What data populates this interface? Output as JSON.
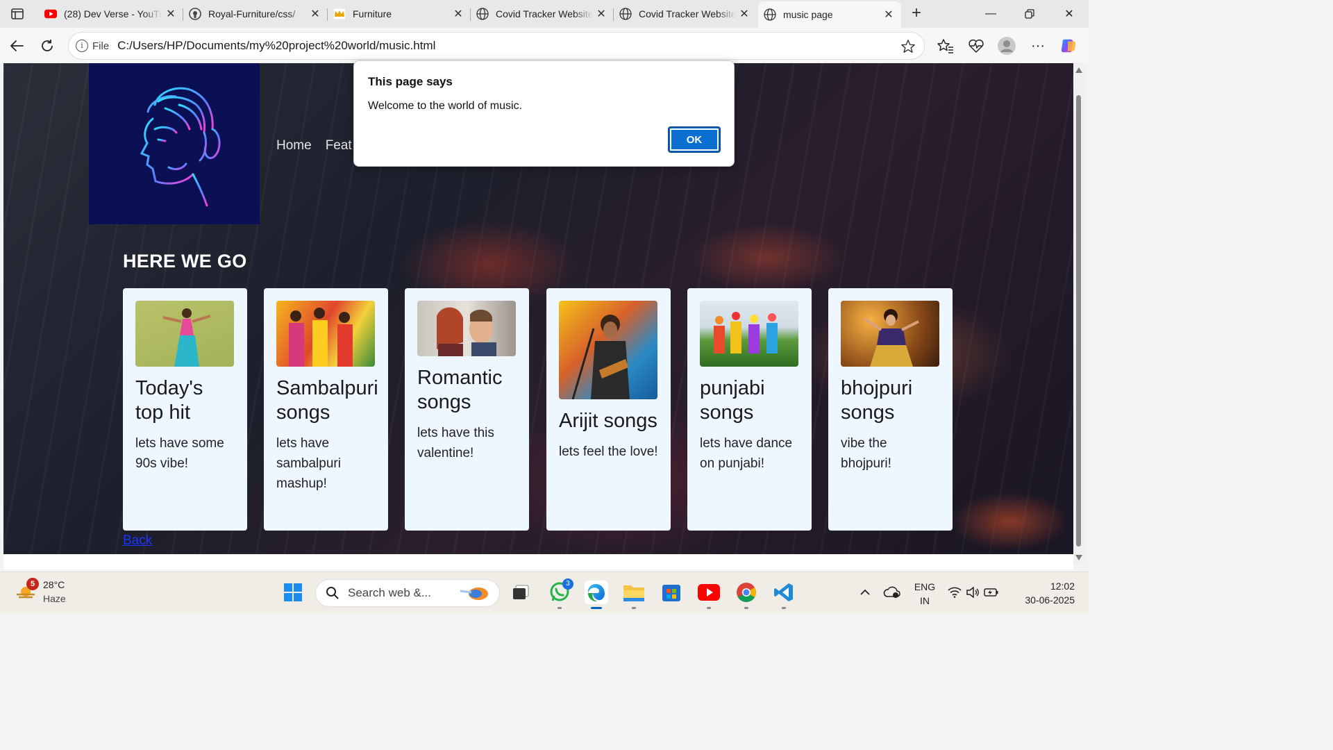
{
  "browser": {
    "tabs": [
      {
        "title": "(28) Dev Verse - YouTube",
        "icon": "youtube-icon"
      },
      {
        "title": "Royal-Furniture/css/",
        "icon": "github-icon"
      },
      {
        "title": "Furniture",
        "icon": "crown-icon"
      },
      {
        "title": "Covid Tracker Website",
        "icon": "globe-icon"
      },
      {
        "title": "Covid Tracker Website",
        "icon": "globe-icon"
      },
      {
        "title": "music page",
        "icon": "globe-icon",
        "active": true
      }
    ],
    "address": {
      "scheme_label": "File",
      "url": "C:/Users/HP/Documents/my%20project%20world/music.html"
    }
  },
  "page": {
    "nav": [
      "Home",
      "Feat"
    ],
    "heading": "HERE WE GO",
    "cards": [
      {
        "title": "Today's top hit",
        "text": "lets have some 90s vibe!"
      },
      {
        "title": "Sambalpuri songs",
        "text": "lets have sambalpuri mashup!"
      },
      {
        "title": "Romantic songs",
        "text": "lets have this valentine!"
      },
      {
        "title": "Arijit songs",
        "text": "lets feel the love!"
      },
      {
        "title": "punjabi songs",
        "text": "lets have dance on punjabi!"
      },
      {
        "title": "bhojpuri songs",
        "text": "vibe the bhojpuri!"
      }
    ],
    "back_link": "Back"
  },
  "dialog": {
    "title": "This page says",
    "message": "Welcome to the world of music.",
    "ok_label": "OK"
  },
  "taskbar": {
    "weather": {
      "badge": "5",
      "temp": "28°C",
      "condition": "Haze"
    },
    "search_placeholder": "Search web &...",
    "whatsapp_badge": "3",
    "language": {
      "lang": "ENG",
      "region": "IN"
    },
    "clock": {
      "time": "12:02",
      "date": "30-06-2025"
    }
  },
  "colors": {
    "accent": "#0a6fd1",
    "card_bg": "#eef7ff",
    "logo_bg": "#0b0f54",
    "link": "#1a33ff"
  }
}
